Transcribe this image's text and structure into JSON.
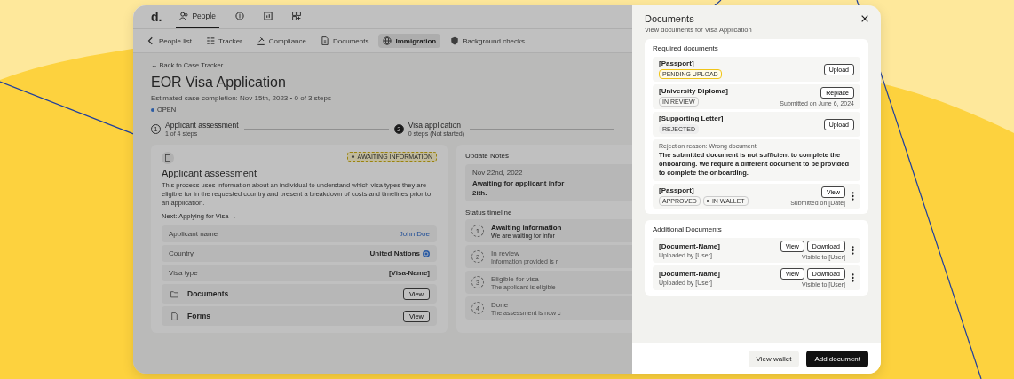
{
  "nav": {
    "logo": "d.",
    "items": [
      {
        "label": "People",
        "selected": true
      },
      {
        "selected": false
      },
      {
        "selected": false
      },
      {
        "selected": false
      }
    ]
  },
  "tabs": [
    {
      "label": "People list",
      "selected": false
    },
    {
      "label": "Tracker",
      "selected": false
    },
    {
      "label": "Compliance",
      "selected": false
    },
    {
      "label": "Documents",
      "selected": false
    },
    {
      "label": "Immigration",
      "selected": true
    },
    {
      "label": "Background checks",
      "selected": false
    }
  ],
  "back": "← Back to Case Tracker",
  "title": "EOR Visa Application",
  "subtitle": "Estimated case completion: Nov 15th, 2023 • 0 of 3 steps",
  "status": "OPEN",
  "steps": [
    {
      "number": "1",
      "title": "Applicant assessment",
      "sub": "1 of 4 steps",
      "kind": "outline"
    },
    {
      "number": "2",
      "title": "Visa application",
      "sub": "0 steps (Not started)",
      "kind": "filled"
    }
  ],
  "assessment": {
    "badge": "AWAITING INFORMATION",
    "title": "Applicant assessment",
    "description": "This process uses information about an individual to understand which visa types they are eligible for in the requested country and present a breakdown of costs and timelines prior to an application.",
    "next": "Next: Applying for Visa →",
    "fields": [
      {
        "label": "Applicant name",
        "value": "John Doe",
        "kind": "link"
      },
      {
        "label": "Country",
        "value": "United Nations",
        "kind": "flag"
      },
      {
        "label": "Visa type",
        "value": "[Visa-Name]",
        "kind": "text"
      }
    ],
    "sections": [
      {
        "label": "Documents",
        "action": "View"
      },
      {
        "label": "Forms",
        "action": "View"
      }
    ]
  },
  "notes": {
    "title": "Update Notes",
    "date": "Nov 22nd, 2022",
    "lines": [
      "Awaiting for applicant infor",
      "2ith."
    ]
  },
  "timeline": {
    "title": "Status timeline",
    "items": [
      {
        "number": "1",
        "title": "Awaiting information",
        "text": "We are waiting for infor",
        "active": true
      },
      {
        "number": "2",
        "title": "In review",
        "text": "Information provided is r",
        "active": false
      },
      {
        "number": "3",
        "title": "Eligible for visa",
        "text": "The applicant is eligible",
        "active": false
      },
      {
        "number": "4",
        "title": "Done",
        "text": "The assessment is now c",
        "active": false
      }
    ]
  },
  "drawer": {
    "title": "Documents",
    "subtitle": "View documents for Visa Application",
    "required": {
      "title": "Required documents",
      "items": [
        {
          "name": "[Passport]",
          "tags": [
            {
              "label": "PENDING UPLOAD",
              "kind": "pending"
            }
          ],
          "actions": [
            "Upload"
          ],
          "menu": false
        },
        {
          "name": "[University Diploma]",
          "tags": [
            {
              "label": "IN REVIEW",
              "kind": "plain"
            }
          ],
          "actions": [
            "Replace"
          ],
          "note": "Submitted on June 6, 2024",
          "menu": false
        },
        {
          "name": "[Supporting Letter]",
          "tags": [
            {
              "label": "REJECTED",
              "kind": "rejected"
            }
          ],
          "actions": [
            "Upload"
          ],
          "menu": false,
          "rejection": {
            "reason": "Rejection reason: Wrong document",
            "message": "The submitted document is not sufficient to complete the onboarding. We require a different document to be provided to complete the onboarding."
          }
        },
        {
          "name": "[Passport]",
          "tags": [
            {
              "label": "APPROVED",
              "kind": "plain"
            },
            {
              "label": "IN WALLET",
              "kind": "dot"
            }
          ],
          "actions": [
            "View"
          ],
          "note": "Submitted on [Date]",
          "menu": true
        }
      ]
    },
    "additional": {
      "title": "Additional Documents",
      "items": [
        {
          "name": "[Document-Name]",
          "actions": [
            "View",
            "Download"
          ],
          "uploaded": "Uploaded by [User]",
          "visible": "Visible to [User]",
          "menu": true
        },
        {
          "name": "[Document-Name]",
          "actions": [
            "View",
            "Download"
          ],
          "uploaded": "Uploaded by [User]",
          "visible": "Visible to [User]",
          "menu": true
        }
      ]
    },
    "buttons": [
      {
        "label": "View wallet",
        "kind": "secondary"
      },
      {
        "label": "Add document",
        "kind": "primary"
      }
    ]
  }
}
